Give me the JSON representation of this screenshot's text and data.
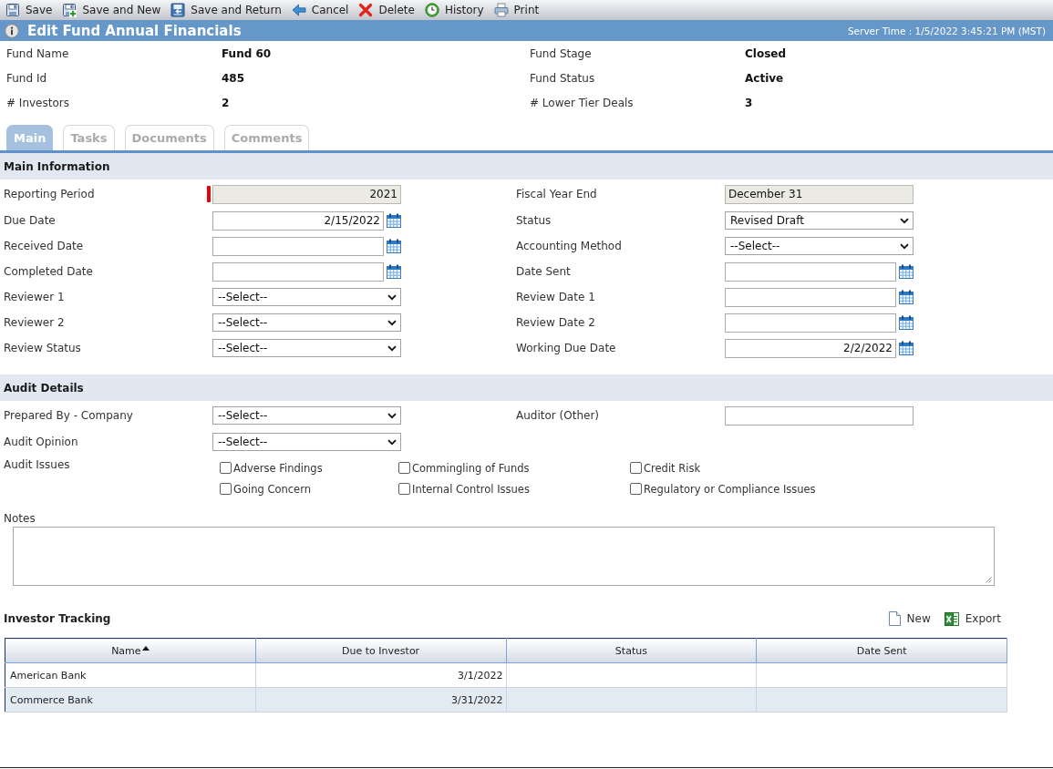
{
  "toolbar": [
    {
      "kind": "save",
      "label": "Save"
    },
    {
      "kind": "savenew",
      "label": "Save and New"
    },
    {
      "kind": "savereturn",
      "label": "Save and Return"
    },
    {
      "kind": "cancel",
      "label": "Cancel"
    },
    {
      "kind": "delete",
      "label": "Delete"
    },
    {
      "kind": "history",
      "label": "History"
    },
    {
      "kind": "print",
      "label": "Print"
    }
  ],
  "header": {
    "title": "Edit Fund Annual Financials",
    "server_time": "Server Time : 1/5/2022 3:45:21 PM (MST)"
  },
  "summary": [
    {
      "label": "Fund Name",
      "value": "Fund 60"
    },
    {
      "label": "Fund Stage",
      "value": "Closed"
    },
    {
      "label": "Fund Id",
      "value": "485"
    },
    {
      "label": "Fund Status",
      "value": "Active"
    },
    {
      "label": "# Investors",
      "value": "2"
    },
    {
      "label": "# Lower Tier Deals",
      "value": "3"
    }
  ],
  "tabs": [
    {
      "label": "Main",
      "selected": true
    },
    {
      "label": "Tasks",
      "selected": false
    },
    {
      "label": "Documents",
      "selected": false
    },
    {
      "label": "Comments",
      "selected": false
    }
  ],
  "sections": [
    {
      "title": "Main Information",
      "rows": [
        [
          {
            "label": "Reporting Period",
            "kind": "number",
            "value": "2021",
            "disabled": true,
            "required": true
          },
          {
            "label": "Fiscal Year End",
            "kind": "text",
            "value": "December 31",
            "disabled": true,
            "required": false
          }
        ],
        [
          {
            "label": "Due Date",
            "kind": "date",
            "value": "2/15/2022",
            "disabled": false,
            "required": false
          },
          {
            "label": "Status",
            "kind": "select",
            "value": "Revised Draft",
            "disabled": false,
            "required": false
          }
        ],
        [
          {
            "label": "Received Date",
            "kind": "date",
            "disabled": false,
            "required": false
          },
          {
            "label": "Accounting Method",
            "kind": "select",
            "value": "--Select--",
            "disabled": false,
            "required": false
          }
        ],
        [
          {
            "label": "Completed Date",
            "kind": "date",
            "disabled": false,
            "required": false
          },
          {
            "label": "Date Sent",
            "kind": "date",
            "disabled": false,
            "required": false
          }
        ],
        [
          {
            "label": "Reviewer 1",
            "kind": "select",
            "value": "--Select--",
            "disabled": false,
            "required": false
          },
          {
            "label": "Review Date 1",
            "kind": "date",
            "disabled": false,
            "required": false
          }
        ],
        [
          {
            "label": "Reviewer 2",
            "kind": "select",
            "value": "--Select--",
            "disabled": false,
            "required": false
          },
          {
            "label": "Review Date 2",
            "kind": "date",
            "disabled": false,
            "required": false
          }
        ],
        [
          {
            "label": "Review Status",
            "kind": "select",
            "value": "--Select--",
            "disabled": false,
            "required": false
          },
          {
            "label": "Working Due Date",
            "kind": "date",
            "value": "2/2/2022",
            "disabled": false,
            "required": false
          }
        ]
      ]
    },
    {
      "title": "Audit Details",
      "rows": [
        [
          {
            "label": "Prepared By - Company",
            "kind": "select",
            "value": "--Select--",
            "disabled": false,
            "required": false
          },
          {
            "label": "Auditor (Other)",
            "kind": "text",
            "disabled": false,
            "required": false
          }
        ],
        [
          {
            "label": "Audit Opinion",
            "kind": "select",
            "value": "--Select--",
            "disabled": false,
            "required": false
          }
        ]
      ],
      "issues": {
        "label": "Audit Issues",
        "options": [
          {
            "label": "Adverse Findings",
            "checked": false
          },
          {
            "label": "Commingling of Funds",
            "checked": false
          },
          {
            "label": "Credit Risk",
            "checked": false
          },
          {
            "label": "Going Concern",
            "checked": false
          },
          {
            "label": "Internal Control Issues",
            "checked": false
          },
          {
            "label": "Regulatory or Compliance Issues",
            "checked": false
          }
        ]
      },
      "notes": {
        "label": "Notes"
      }
    }
  ],
  "investor_tracking": {
    "title": "Investor Tracking",
    "actions": [
      {
        "kind": "new",
        "label": "New"
      },
      {
        "kind": "export",
        "label": "Export"
      }
    ],
    "columns": [
      {
        "label": "Name",
        "kind": "text",
        "sorted": true
      },
      {
        "label": "Due to Investor",
        "kind": "date",
        "sorted": false
      },
      {
        "label": "Status",
        "kind": "text",
        "sorted": false
      },
      {
        "label": "Date Sent",
        "kind": "date",
        "sorted": false
      }
    ],
    "rows": [
      {
        "cells": [
          "American Bank",
          "3/1/2022"
        ]
      },
      {
        "cells": [
          "Commerce Bank",
          "3/31/2022"
        ]
      }
    ]
  }
}
